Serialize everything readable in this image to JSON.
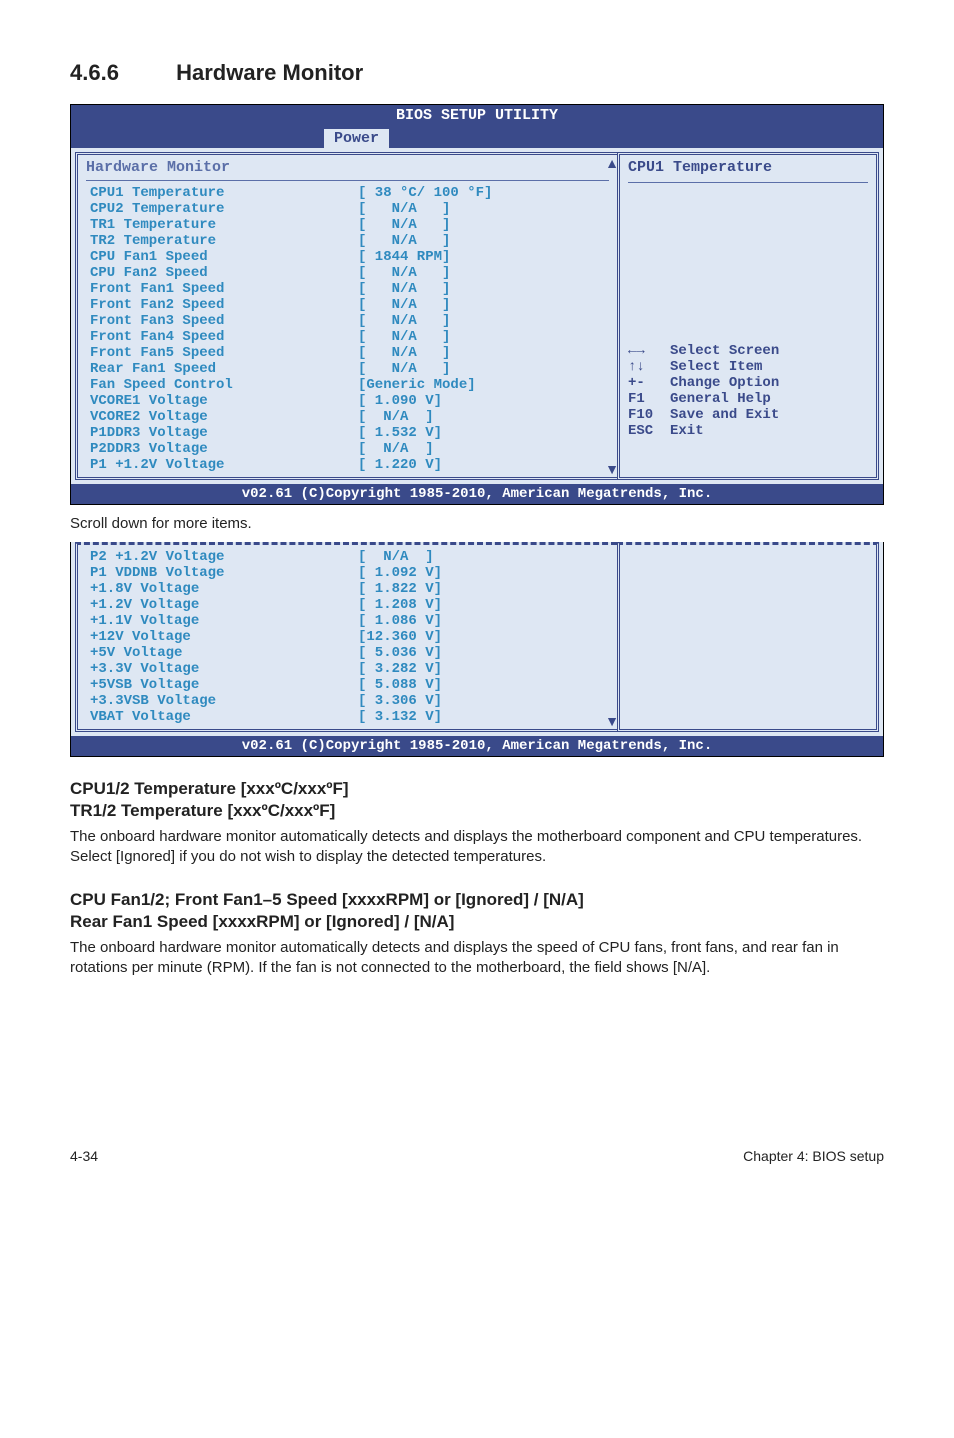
{
  "heading": {
    "number": "4.6.6",
    "title": "Hardware Monitor"
  },
  "bios1": {
    "top_title": "BIOS SETUP UTILITY",
    "tab": "Power",
    "panel_title": "Hardware Monitor",
    "right_title": "CPU1 Temperature",
    "rows": [
      {
        "label": "CPU1 Temperature",
        "value": "[ 38 °C/ 100 °F]"
      },
      {
        "label": "CPU2 Temperature",
        "value": "[   N/A   ]"
      },
      {
        "label": "TR1 Temperature",
        "value": "[   N/A   ]"
      },
      {
        "label": "TR2 Temperature",
        "value": "[   N/A   ]"
      },
      {
        "label": "CPU Fan1 Speed",
        "value": "[ 1844 RPM]"
      },
      {
        "label": "CPU Fan2 Speed",
        "value": "[   N/A   ]"
      },
      {
        "label": "Front Fan1 Speed",
        "value": "[   N/A   ]"
      },
      {
        "label": "Front Fan2 Speed",
        "value": "[   N/A   ]"
      },
      {
        "label": "Front Fan3 Speed",
        "value": "[   N/A   ]"
      },
      {
        "label": "Front Fan4 Speed",
        "value": "[   N/A   ]"
      },
      {
        "label": "Front Fan5 Speed",
        "value": "[   N/A   ]"
      },
      {
        "label": "Rear Fan1 Speed",
        "value": "[   N/A   ]"
      },
      {
        "label": "Fan Speed Control",
        "value": "[Generic Mode]"
      },
      {
        "label": "VCORE1 Voltage",
        "value": "[ 1.090 V]"
      },
      {
        "label": "VCORE2 Voltage",
        "value": "[  N/A  ]"
      },
      {
        "label": "P1DDR3 Voltage",
        "value": "[ 1.532 V]"
      },
      {
        "label": "P2DDR3 Voltage",
        "value": "[  N/A  ]"
      },
      {
        "label": "P1 +1.2V Voltage",
        "value": "[ 1.220 V]"
      }
    ],
    "help": [
      {
        "key": "←→",
        "text": "Select Screen"
      },
      {
        "key": "↑↓",
        "text": "Select Item"
      },
      {
        "key": "+-",
        "text": "Change Option"
      },
      {
        "key": "F1",
        "text": "General Help"
      },
      {
        "key": "F10",
        "text": "Save and Exit"
      },
      {
        "key": "ESC",
        "text": "Exit"
      }
    ],
    "footer": "v02.61 (C)Copyright 1985-2010, American Megatrends, Inc."
  },
  "caption": "Scroll down for more items.",
  "bios2": {
    "rows": [
      {
        "label": "P2 +1.2V Voltage",
        "value": "[  N/A  ]"
      },
      {
        "label": "P1 VDDNB Voltage",
        "value": "[ 1.092 V]"
      },
      {
        "label": "+1.8V Voltage",
        "value": "[ 1.822 V]"
      },
      {
        "label": "+1.2V Voltage",
        "value": "[ 1.208 V]"
      },
      {
        "label": "+1.1V Voltage",
        "value": "[ 1.086 V]"
      },
      {
        "label": "+12V Voltage",
        "value": "[12.360 V]"
      },
      {
        "label": "+5V Voltage",
        "value": "[ 5.036 V]"
      },
      {
        "label": "+3.3V Voltage",
        "value": "[ 3.282 V]"
      },
      {
        "label": "+5VSB Voltage",
        "value": "[ 5.088 V]"
      },
      {
        "label": "+3.3VSB Voltage",
        "value": "[ 3.306 V]"
      },
      {
        "label": "VBAT Voltage",
        "value": "[ 3.132 V]"
      }
    ],
    "footer": "v02.61 (C)Copyright 1985-2010, American Megatrends, Inc."
  },
  "sub1": {
    "line1": "CPU1/2 Temperature [xxxºC/xxxºF]",
    "line2": "TR1/2 Temperature [xxxºC/xxxºF]",
    "body": "The onboard hardware monitor automatically detects and displays the motherboard component and CPU temperatures. Select [Ignored] if you do not wish to display the detected temperatures."
  },
  "sub2": {
    "line1": "CPU Fan1/2; Front Fan1–5 Speed [xxxxRPM] or [Ignored] / [N/A]",
    "line2": "Rear Fan1 Speed [xxxxRPM] or [Ignored] / [N/A]",
    "body": "The onboard hardware monitor automatically detects and displays the speed of CPU fans, front fans, and rear fan in rotations per minute (RPM). If the fan is not connected to the motherboard, the field shows [N/A]."
  },
  "footer": {
    "left": "4-34",
    "right": "Chapter 4: BIOS setup"
  }
}
